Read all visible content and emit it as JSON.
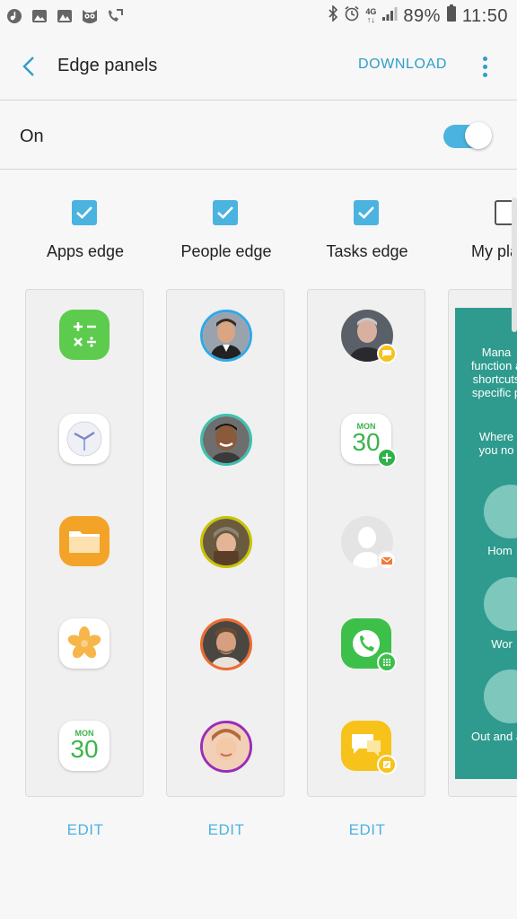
{
  "status_bar": {
    "battery": "89%",
    "time": "11:50",
    "network": "4G"
  },
  "app_bar": {
    "title": "Edge panels",
    "download": "DOWNLOAD"
  },
  "master_switch": {
    "label": "On",
    "state": "on"
  },
  "panels": [
    {
      "label": "Apps edge",
      "checked": true,
      "edit": "EDIT",
      "items": [
        "calculator-icon",
        "clock-icon",
        "my-files-icon",
        "gallery-icon",
        "calendar-icon"
      ]
    },
    {
      "label": "People edge",
      "checked": true,
      "edit": "EDIT",
      "items": [
        "contact-1",
        "contact-2",
        "contact-3",
        "contact-4",
        "contact-5"
      ]
    },
    {
      "label": "Tasks edge",
      "checked": true,
      "edit": "EDIT",
      "items": [
        "message-contact-task",
        "create-event-task",
        "compose-email-task",
        "dial-task",
        "compose-message-task"
      ]
    },
    {
      "label": "My pla",
      "checked": false
    }
  ],
  "calendar": {
    "day": "MON",
    "date": "30"
  },
  "my_place": {
    "intro": [
      "Mana",
      "function a",
      "shortcuts",
      "specific p"
    ],
    "prompt": [
      "Where",
      "you no"
    ],
    "places": [
      "Hom",
      "Wor",
      "Out and a"
    ]
  },
  "colors": {
    "accent": "#4bb3e0",
    "link": "#2f9ec9",
    "teal": "#2e9b8e"
  }
}
